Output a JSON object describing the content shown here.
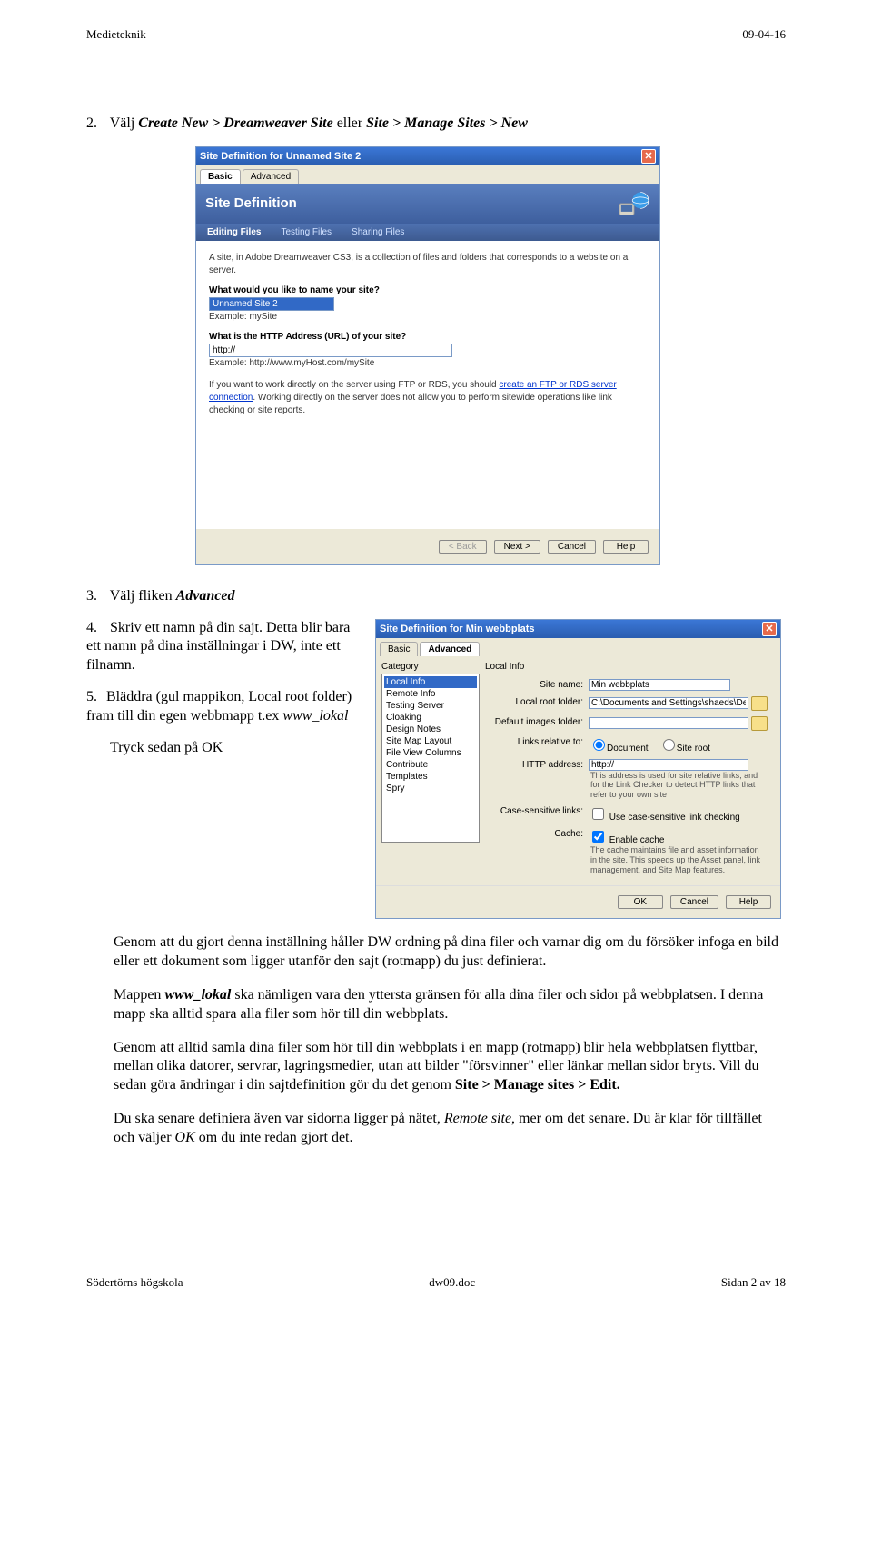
{
  "header": {
    "left": "Medieteknik",
    "right": "09-04-16"
  },
  "step2": {
    "prefix": "2.",
    "t1": "Välj ",
    "t2": "Create New > Dreamweaver Site",
    "t3": " eller ",
    "t4": "Site > Manage Sites > New"
  },
  "dialog1": {
    "title": "Site Definition for Unnamed Site 2",
    "tab_basic": "Basic",
    "tab_advanced": "Advanced",
    "wizard_title": "Site Definition",
    "subtabs": {
      "a": "Editing Files",
      "b": "Testing Files",
      "c": "Sharing Files"
    },
    "intro": "A site, in Adobe Dreamweaver CS3, is a collection of files and folders that corresponds to a website on a server.",
    "q1": "What would you like to name your site?",
    "name_val": "Unnamed Site 2",
    "ex1": "Example: mySite",
    "q2": "What is the HTTP Address (URL) of your site?",
    "http_val": "http://",
    "ex2": "Example: http://www.myHost.com/mySite",
    "ftp_note1": "If you want to work directly on the server using FTP or RDS, you should ",
    "ftp_link": "create an FTP or RDS server connection",
    "ftp_note2": ". Working directly on the server does not allow you to perform sitewide operations like link checking or site reports.",
    "btn_back": "< Back",
    "btn_next": "Next >",
    "btn_cancel": "Cancel",
    "btn_help": "Help"
  },
  "step3": {
    "prefix": "3.",
    "t1": "Välj fliken ",
    "t2": "Advanced"
  },
  "step4": {
    "prefix": "4.",
    "line1": " Skriv ett namn på din sajt. Detta blir bara ett namn på dina inställningar i DW, inte ett filnamn."
  },
  "step5": {
    "prefix": "5.",
    "line1": "Bläddra (gul mappikon, Local root folder) fram till din egen webbmapp t.ex ",
    "line1_em": "www_lokal"
  },
  "step5b": "Tryck sedan på OK",
  "dialog2": {
    "title": "Site Definition for Min webbplats",
    "tab_basic": "Basic",
    "tab_advanced": "Advanced",
    "cat_label": "Category",
    "cats": [
      "Local Info",
      "Remote Info",
      "Testing Server",
      "Cloaking",
      "Design Notes",
      "Site Map Layout",
      "File View Columns",
      "Contribute",
      "Templates",
      "Spry"
    ],
    "panel_title": "Local Info",
    "site_name_lbl": "Site name:",
    "site_name_val": "Min webbplats",
    "root_lbl": "Local root folder:",
    "root_val": "C:\\Documents and Settings\\shaeds\\Desktop\\www_",
    "img_lbl": "Default images folder:",
    "img_val": "",
    "links_lbl": "Links relative to:",
    "links_doc": "Document",
    "links_site": "Site root",
    "http_lbl": "HTTP address:",
    "http_val": "http://",
    "http_note": "This address is used for site relative links, and for the Link Checker to detect HTTP links that refer to your own site",
    "case_lbl": "Case-sensitive links:",
    "case_chk": "Use case-sensitive link checking",
    "cache_lbl": "Cache:",
    "cache_chk": "Enable cache",
    "cache_note": "The cache maintains file and asset information in the site. This speeds up the Asset panel, link management, and Site Map features.",
    "btn_ok": "OK",
    "btn_cancel": "Cancel",
    "btn_help": "Help"
  },
  "p1": "Genom att du gjort denna inställning håller DW ordning på dina filer och varnar dig om du försöker infoga en bild eller ett dokument som ligger utanför den sajt (rotmapp) du just definierat.",
  "p2a": "Mappen ",
  "p2b": "www_lokal",
  "p2c": " ska nämligen vara den yttersta gränsen för alla dina filer och sidor på webbplatsen. I denna mapp ska alltid spara alla filer som hör till din webbplats.",
  "p3a": "Genom att alltid samla dina filer som hör till din webbplats i en mapp (rotmapp) blir hela webbplatsen flyttbar, mellan olika datorer, servrar, lagringsmedier, utan att bilder \"försvinner\" eller länkar mellan sidor bryts. Vill du sedan göra ändringar i din sajtdefinition gör du det genom ",
  "p3b": "Site > Manage sites > Edit.",
  "p4a": "Du ska senare definiera även var sidorna ligger på nätet, ",
  "p4b": "Remote site",
  "p4c": ", mer om det senare. Du är klar för tillfället och väljer ",
  "p4d": "OK",
  "p4e": " om du inte redan gjort det.",
  "footer": {
    "left": "Södertörns högskola",
    "center": "dw09.doc",
    "right": "Sidan 2 av 18"
  }
}
